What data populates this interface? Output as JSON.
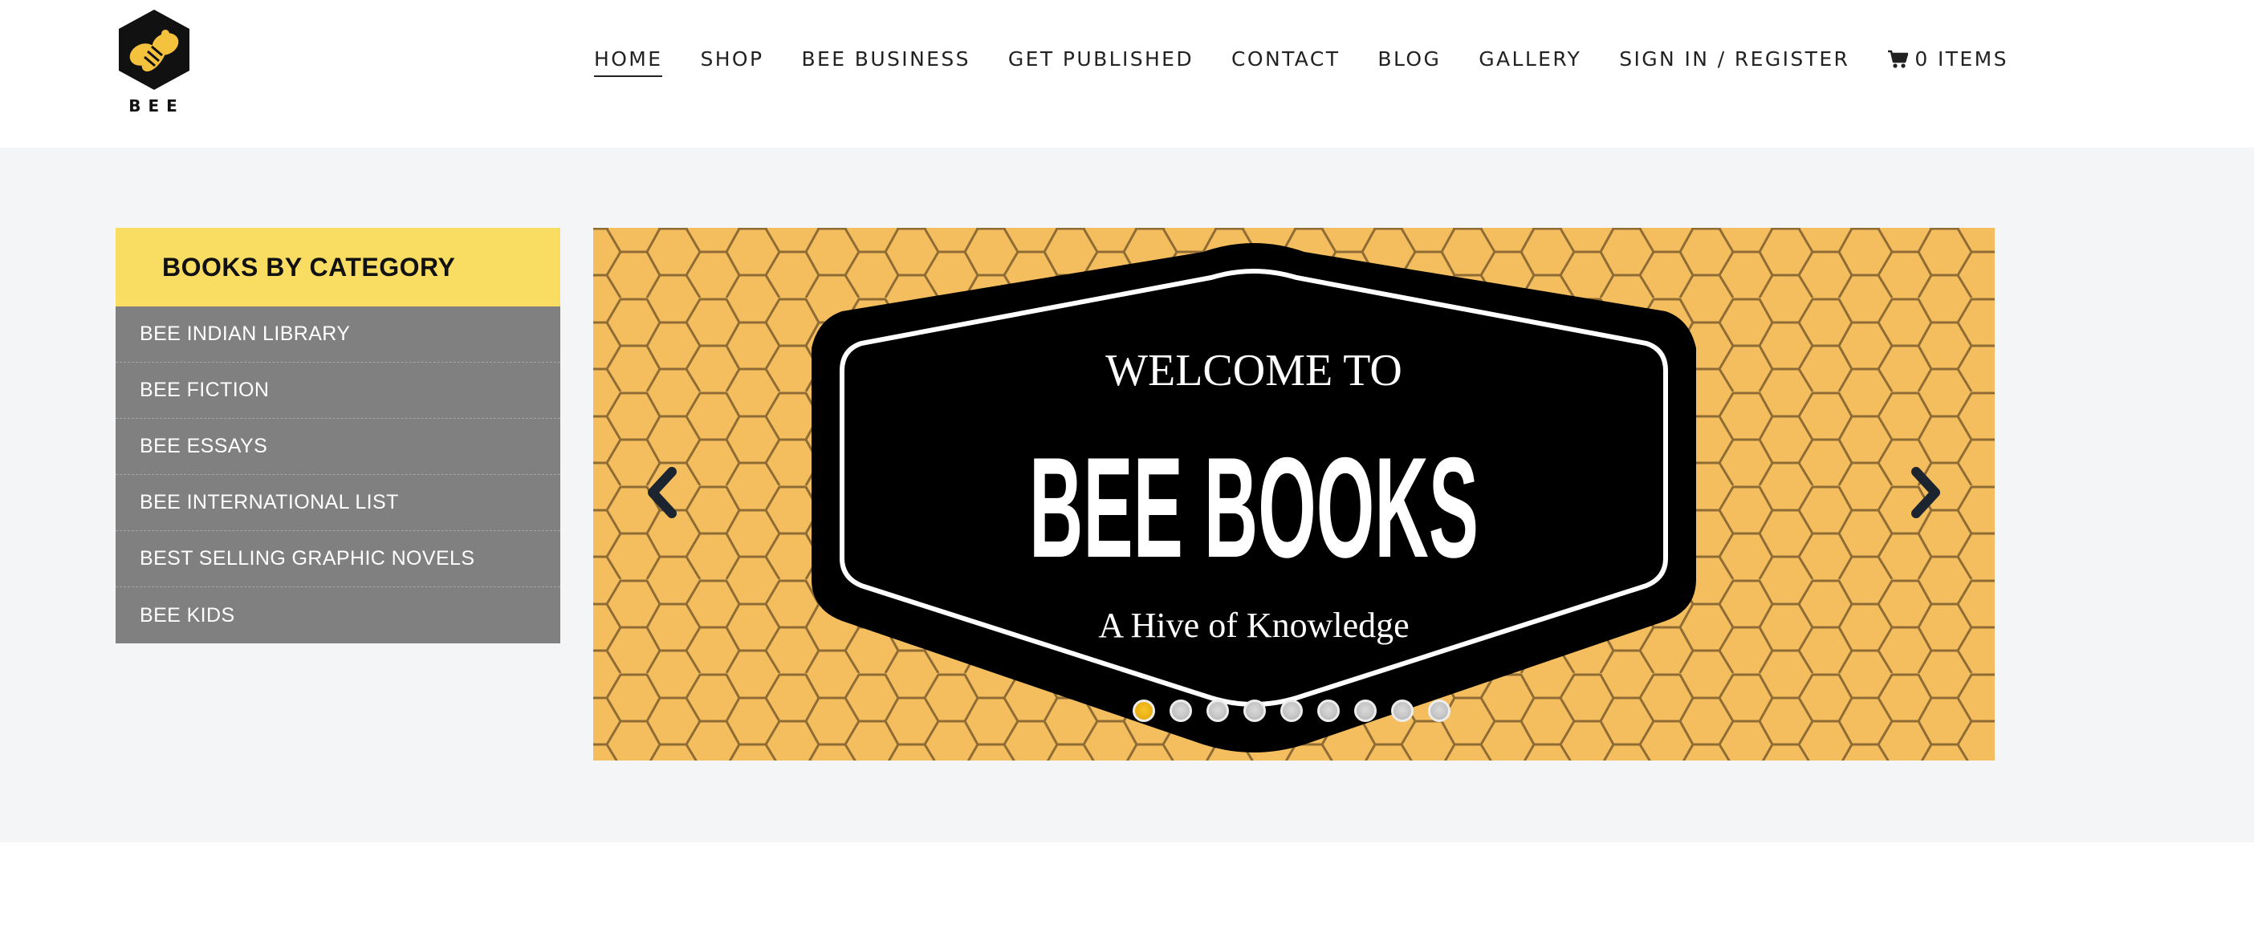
{
  "logo": {
    "text": "BEE",
    "icon": "bee-hexagon-logo",
    "colors": {
      "hex": "#111111",
      "bee": "#f5c23e"
    }
  },
  "nav": {
    "items": [
      {
        "label": "HOME",
        "active": true
      },
      {
        "label": "SHOP"
      },
      {
        "label": "BEE BUSINESS"
      },
      {
        "label": "GET PUBLISHED"
      },
      {
        "label": "CONTACT"
      },
      {
        "label": "BLOG"
      },
      {
        "label": "GALLERY"
      },
      {
        "label": "SIGN IN / REGISTER"
      }
    ],
    "cart": {
      "icon": "shopping-cart-icon",
      "label": "0 ITEMS"
    }
  },
  "sidebar": {
    "title": "BOOKS BY CATEGORY",
    "items": [
      {
        "label": "BEE INDIAN LIBRARY"
      },
      {
        "label": "BEE FICTION"
      },
      {
        "label": "BEE ESSAYS"
      },
      {
        "label": "BEE INTERNATIONAL LIST"
      },
      {
        "label": "BEST SELLING GRAPHIC NOVELS"
      },
      {
        "label": "BEE KIDS"
      }
    ]
  },
  "slider": {
    "welcome": "WELCOME TO",
    "title": "BEE BOOKS",
    "tagline": "A Hive of Knowledge",
    "prev_icon": "chevron-left-icon",
    "next_icon": "chevron-right-icon",
    "slide_count": 9,
    "active_slide": 1
  },
  "colors": {
    "accent": "#f9dd62",
    "sidebar_bg": "#808080",
    "honeycomb": "#f4be5f",
    "band_bg": "#f4f5f7"
  }
}
